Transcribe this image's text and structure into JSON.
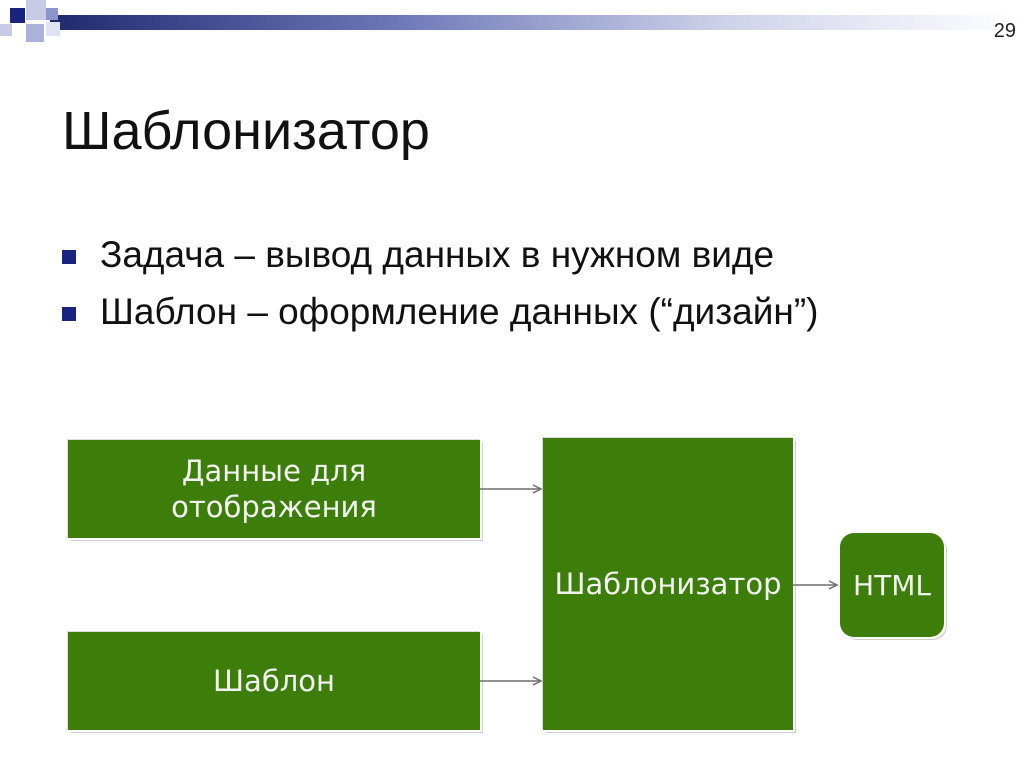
{
  "slide": {
    "page_number": "29",
    "title": "Шаблонизатор",
    "bullets": [
      "Задача – вывод данных в нужном виде",
      "Шаблон – оформление данных (“дизайн”)"
    ]
  },
  "diagram": {
    "data_box": "Данные для отображения",
    "template_box": "Шаблон",
    "engine_box": "Шаблонизатор",
    "output_box": "HTML"
  },
  "colors": {
    "box_fill": "#3d7d0a",
    "bullet_marker": "#1a237e"
  },
  "icons": {
    "bullet": "square-bullet-icon"
  }
}
